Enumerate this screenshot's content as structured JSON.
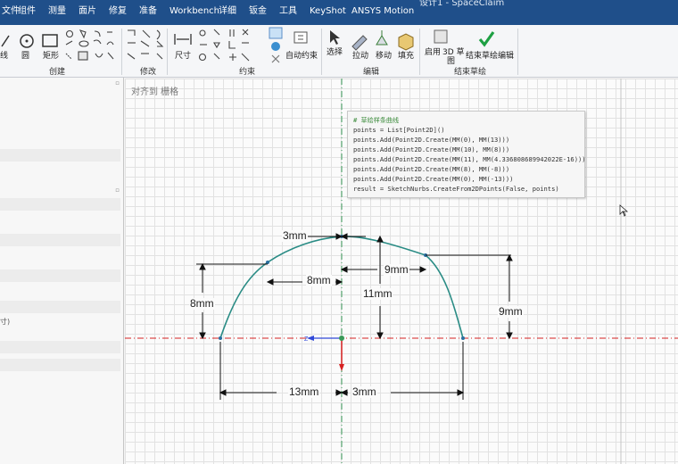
{
  "window": {
    "title": "设计1 - SpaceClaim"
  },
  "menu": {
    "items": [
      "文件",
      "组件",
      "测量",
      "面片",
      "修复",
      "准备",
      "Workbench",
      "详细",
      "钣金",
      "工具",
      "KeyShot",
      "ANSYS Motion"
    ]
  },
  "ribbon": {
    "groups": {
      "create": "创建",
      "modify": "修改",
      "constraints": "约束",
      "edit": "编辑",
      "end_sketch": "结束草绘"
    },
    "buttons": {
      "line": "线",
      "circle": "圆",
      "rectangle": "矩形",
      "dimension": "尺寸",
      "auto_constrain": "自动约束",
      "select": "选择",
      "pull": "拉动",
      "move": "移动",
      "fill": "填充",
      "enable_3d_l1": "启用",
      "enable_3d_l2": "3D 草",
      "enable_3d_l3": "图",
      "end_sketch_edit": "结束草绘编辑"
    }
  },
  "left_panel": {
    "snippet": "寸)"
  },
  "canvas": {
    "align_label": "对齐到 栅格",
    "code": [
      "# 草绘样条曲线",
      "points = List[Point2D]()",
      "points.Add(Point2D.Create(MM(0), MM(13)))",
      "points.Add(Point2D.Create(MM(10), MM(8)))",
      "points.Add(Point2D.Create(MM(11), MM(4.336808689942022E-16)))",
      "points.Add(Point2D.Create(MM(8), MM(-8)))",
      "points.Add(Point2D.Create(MM(0), MM(-13)))",
      "result = SketchNurbs.CreateFrom2DPoints(False, points)"
    ],
    "dimensions": {
      "top_3mm": "3mm",
      "left_8mm": "8mm",
      "vert_8mm": "8mm",
      "right_9mm": "9mm",
      "vert_11mm": "11mm",
      "side_9mm": "9mm",
      "bottom_13mm": "13mm",
      "bottom_3mm": "3mm"
    }
  },
  "colors": {
    "curve": "#2a8c85",
    "menubar": "#1f4f8a",
    "axis_red": "#d62020",
    "axis_green": "#3a9a58",
    "axis_blue": "#3048d8"
  }
}
